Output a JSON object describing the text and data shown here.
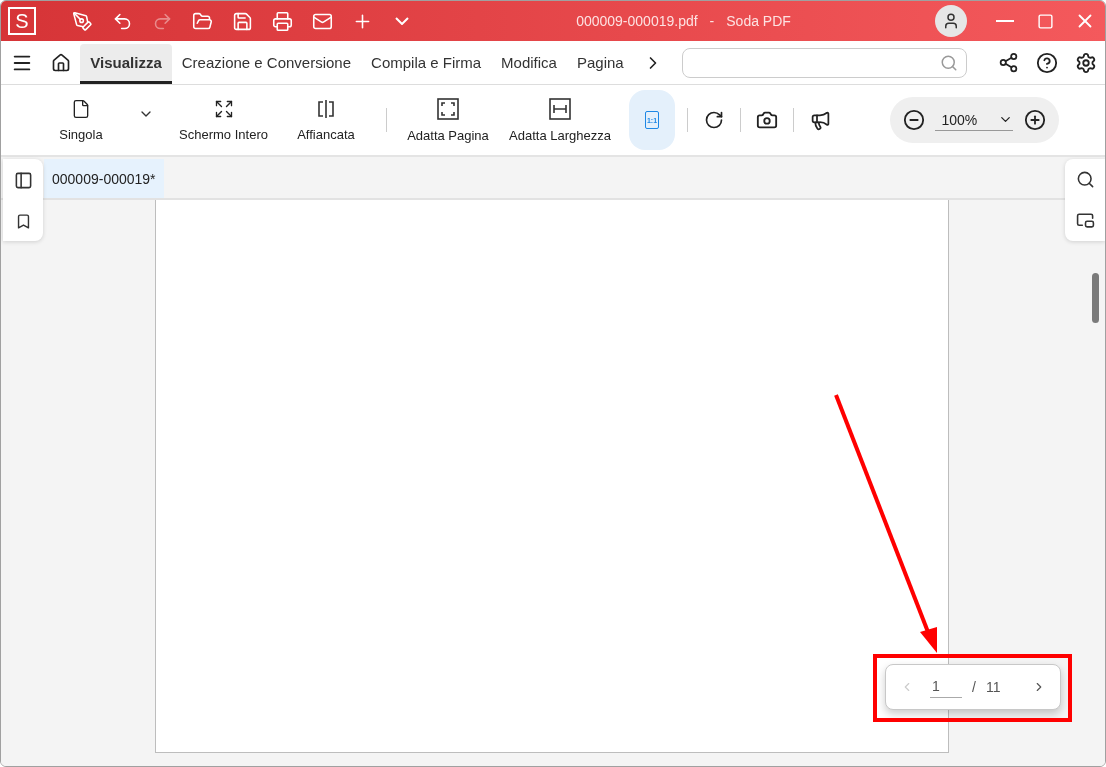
{
  "title_bar": {
    "logo": "S",
    "file_name": "000009-000019.pdf",
    "separator": "-",
    "app_name": "Soda PDF"
  },
  "tabs": [
    {
      "label": "Visualizza",
      "selected": true
    },
    {
      "label": "Creazione e Conversione",
      "selected": false
    },
    {
      "label": "Compila e Firma",
      "selected": false
    },
    {
      "label": "Modifica",
      "selected": false
    },
    {
      "label": "Pagina",
      "selected": false
    }
  ],
  "toolbar": {
    "buttons": [
      {
        "kind": "single",
        "label": "Singola"
      },
      {
        "kind": "fullscreen",
        "label": "Schermo Intero"
      },
      {
        "kind": "side",
        "label": "Affiancata"
      },
      {
        "kind": "fit_page",
        "label": "Adatta Pagina"
      },
      {
        "kind": "fit_width",
        "label": "Adatta Larghezza"
      }
    ],
    "actual_size": {
      "label": "1:1",
      "selected": true
    },
    "zoom": "100%"
  },
  "document_tab": {
    "label": "000009-000019*",
    "selected": true
  },
  "page_nav": {
    "current": "1",
    "separator": "/",
    "total": "11"
  }
}
